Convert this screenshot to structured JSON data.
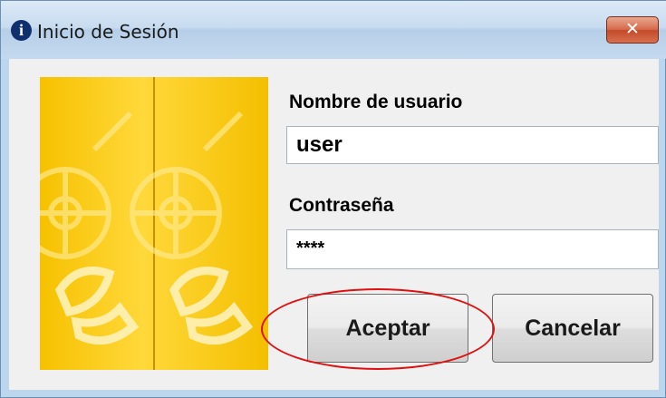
{
  "window": {
    "title": "Inicio de Sesión",
    "close_glyph": "✕"
  },
  "form": {
    "username_label": "Nombre de usuario",
    "username_value": "user",
    "password_label": "Contraseña",
    "password_value": "****"
  },
  "buttons": {
    "accept_label": "Aceptar",
    "cancel_label": "Cancelar"
  },
  "icons": {
    "title_icon": "info-icon",
    "banner": "vault-logo-illustration"
  },
  "colors": {
    "banner_yellow": "#f6c100",
    "highlight_red": "#e01010"
  }
}
